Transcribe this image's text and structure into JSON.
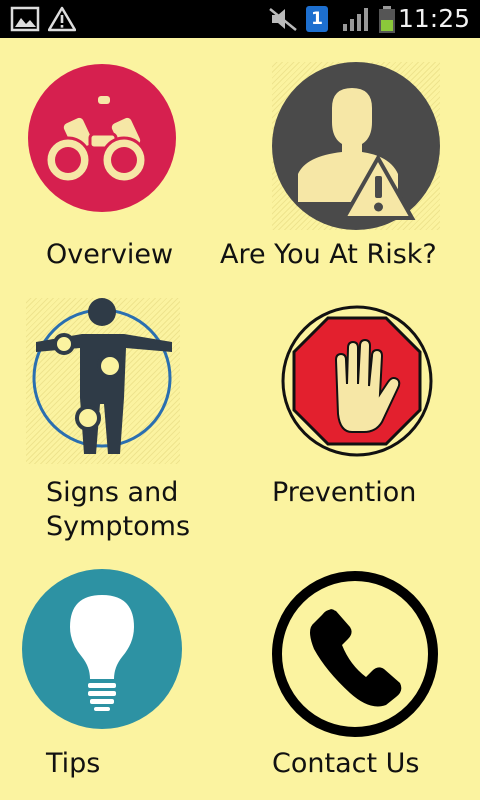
{
  "status_bar": {
    "time": "11:25",
    "left_icons": [
      "gallery-icon",
      "warning-icon"
    ],
    "right_icons": [
      "mute-icon",
      "sim-icon",
      "signal-icon",
      "battery-icon"
    ],
    "sim_slot": "1"
  },
  "menu": {
    "items": [
      {
        "label": "Overview",
        "icon": "binoculars-icon",
        "color": "#d6204f"
      },
      {
        "label": "Are You At Risk?",
        "icon": "person-warning-icon",
        "color": "#4a4a4a"
      },
      {
        "label_line1": "Signs and",
        "label_line2": "Symptoms",
        "icon": "body-symptoms-icon",
        "color": "#2f3b47"
      },
      {
        "label": "Prevention",
        "icon": "stop-hand-icon",
        "color": "#e3202e"
      },
      {
        "label": "Tips",
        "icon": "lightbulb-icon",
        "color": "#2d92a3"
      },
      {
        "label": "Contact Us",
        "icon": "phone-icon",
        "color": "#000000"
      }
    ]
  },
  "colors": {
    "background": "#fbf3a0",
    "status_bar": "#000000"
  }
}
